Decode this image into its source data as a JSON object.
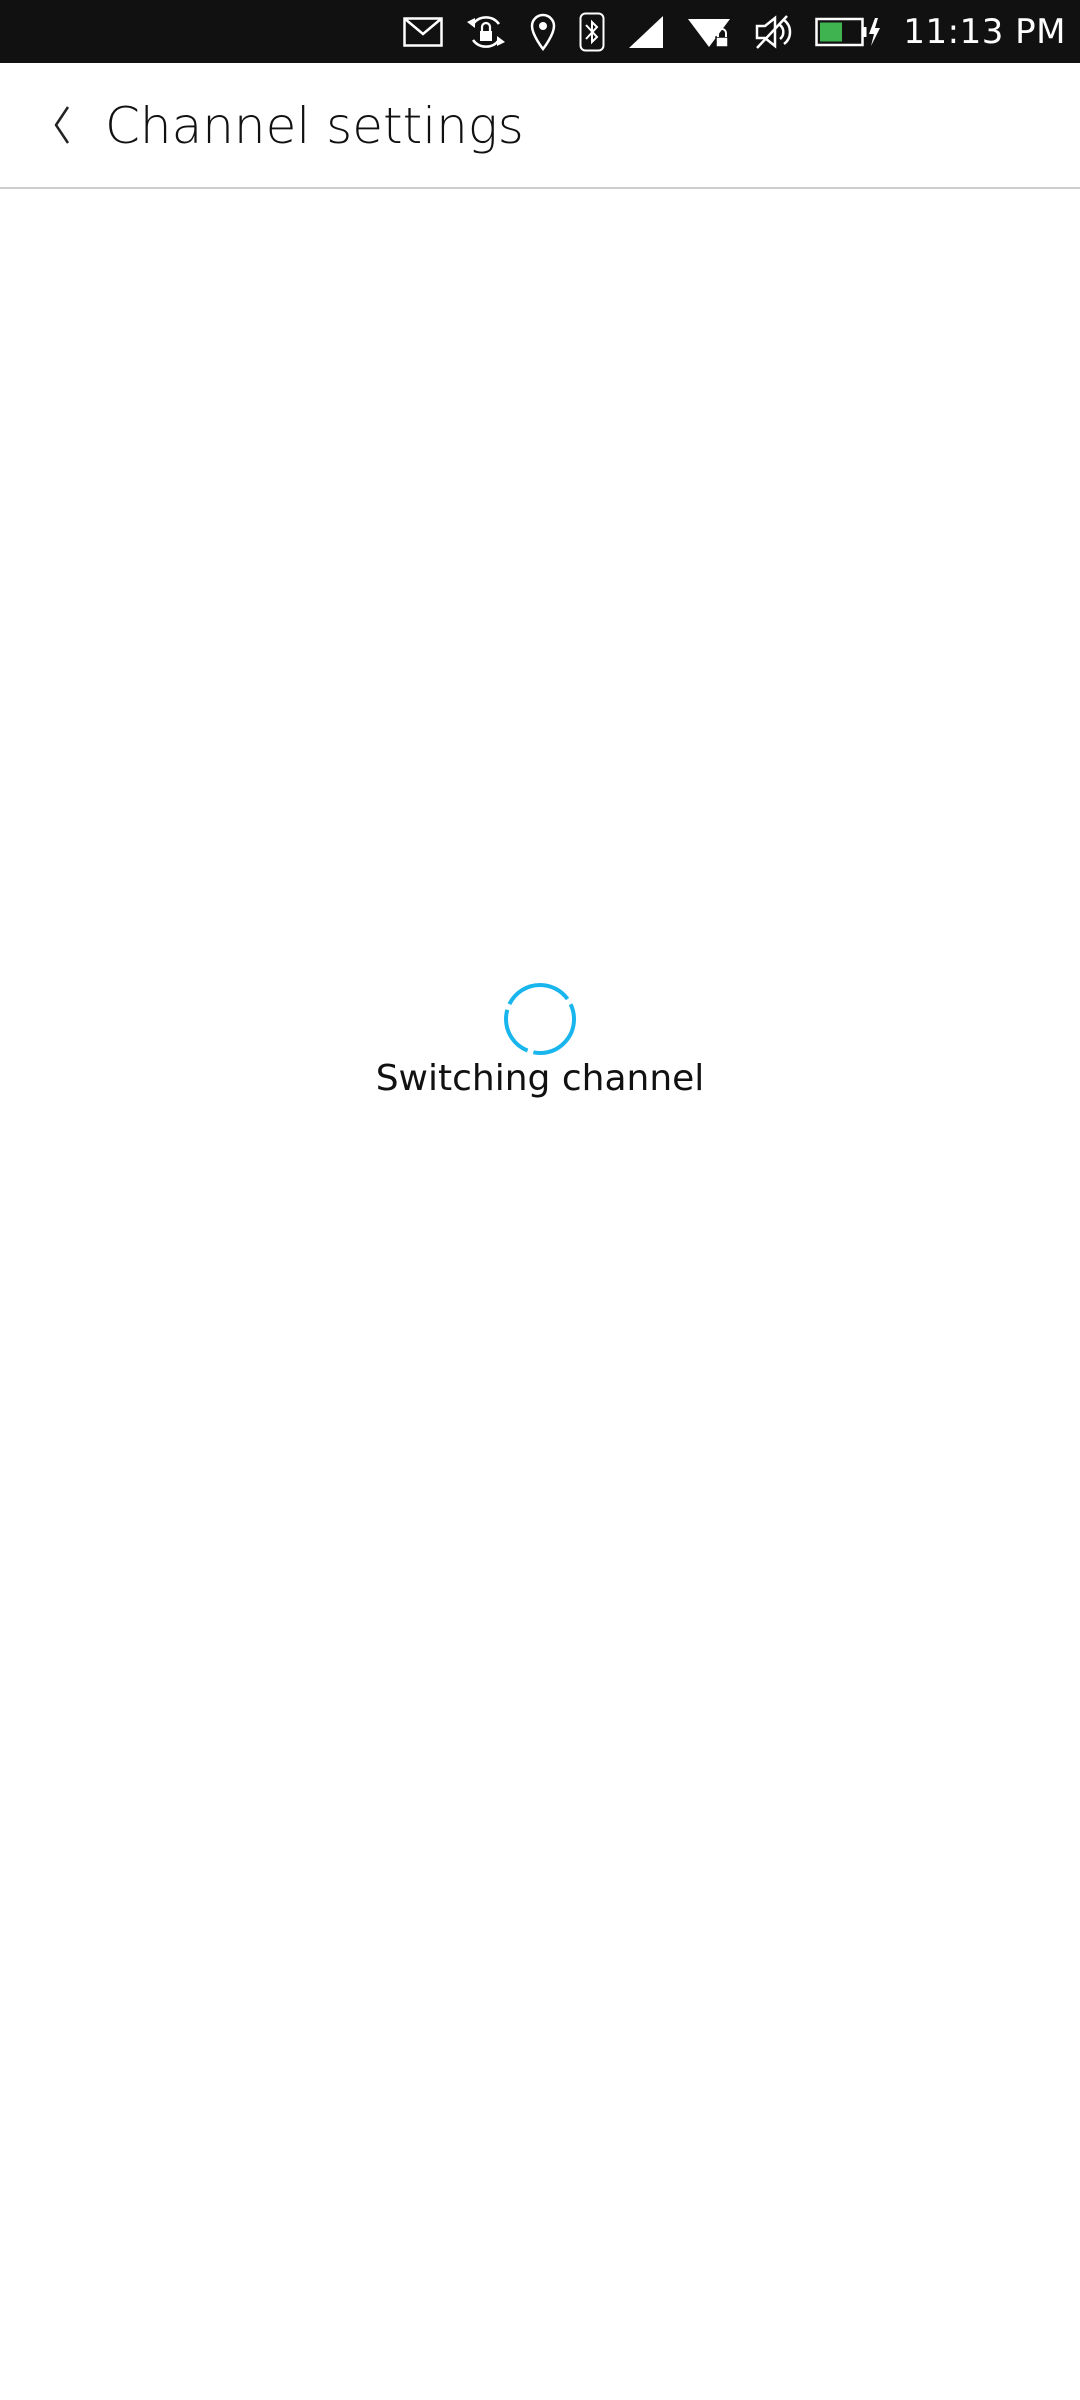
{
  "status_bar": {
    "time": "11:13 PM",
    "icons": [
      "mail-icon",
      "rotation-lock-icon",
      "location-icon",
      "bluetooth-icon",
      "cellular-signal-icon",
      "wifi-icon",
      "volume-muted-icon",
      "battery-charging-icon"
    ],
    "battery_color": "#3eb34f"
  },
  "header": {
    "title": "Channel settings",
    "back_icon": "chevron-left-icon"
  },
  "main": {
    "loading_text": "Switching channel",
    "spinner_color": "#19b6ee"
  }
}
